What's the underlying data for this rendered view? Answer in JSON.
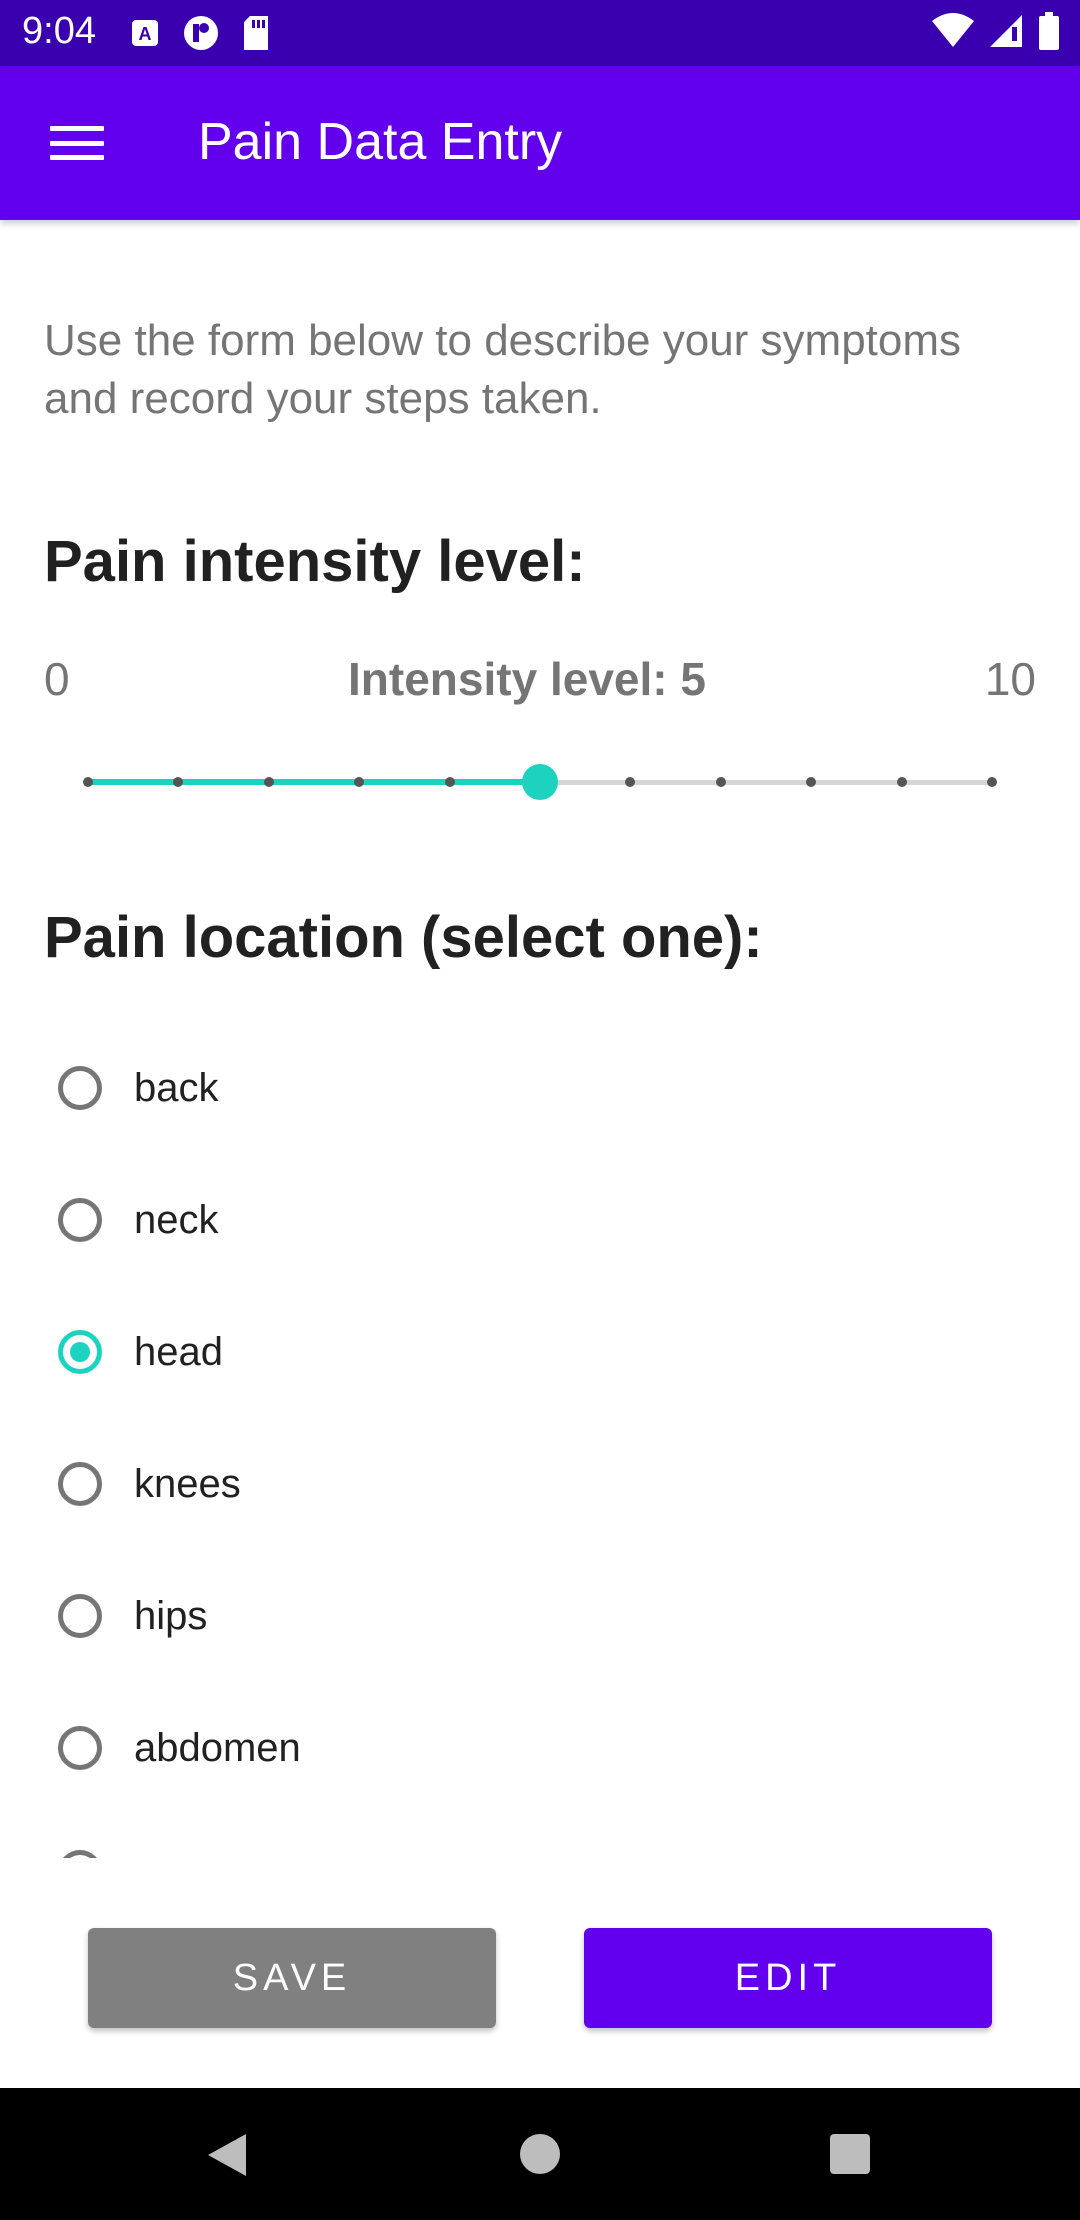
{
  "status_bar": {
    "time": "9:04",
    "left_icons": [
      "a11y-icon",
      "data-saver-icon",
      "sd-card-icon"
    ],
    "right_icons": [
      "wifi-icon",
      "signal-icon",
      "battery-icon"
    ]
  },
  "app_bar": {
    "title": "Pain Data Entry",
    "menu_icon": "hamburger-menu-icon",
    "color": "#6200ee"
  },
  "intro_text": "Use the form below to describe your symptoms and record your steps taken.",
  "intensity": {
    "heading": "Pain intensity level:",
    "min_label": "0",
    "max_label": "10",
    "value_label": "Intensity level: 5",
    "min": 0,
    "max": 10,
    "value": 5,
    "accent": "#1ed2c0"
  },
  "location": {
    "heading": "Pain location (select one):",
    "options": [
      {
        "label": "back",
        "checked": false
      },
      {
        "label": "neck",
        "checked": false
      },
      {
        "label": "head",
        "checked": true
      },
      {
        "label": "knees",
        "checked": false
      },
      {
        "label": "hips",
        "checked": false
      },
      {
        "label": "abdomen",
        "checked": false
      }
    ]
  },
  "buttons": {
    "save_label": "SAVE",
    "edit_label": "EDIT"
  },
  "nav_bar": {
    "icons": [
      "back-icon",
      "home-icon",
      "recents-icon"
    ]
  }
}
